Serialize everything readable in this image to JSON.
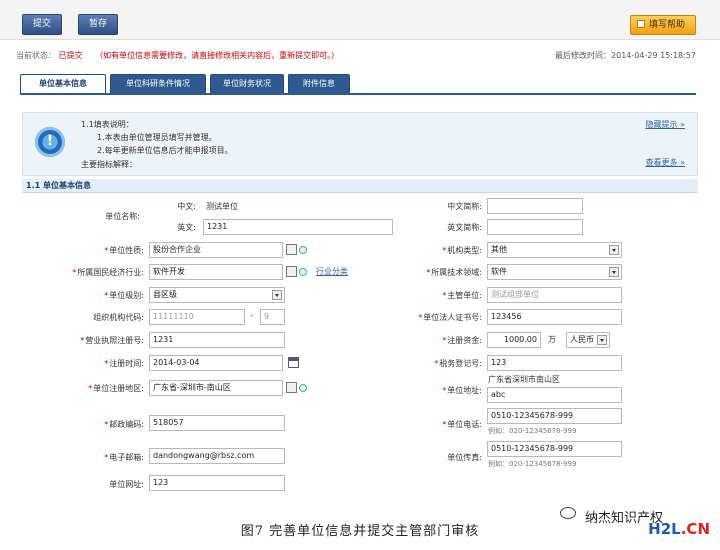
{
  "toolbar": {
    "submit": "提交",
    "save": "暂存",
    "help": "填写帮助"
  },
  "status": {
    "label": "当前状态：",
    "value": "已提交",
    "note": "（如有单位信息需要修改，请直接修改相关内容后，重新提交即可。）",
    "modified_label": "最后修改时间：",
    "modified_value": "2014-04-29 15:18:57"
  },
  "tabs": [
    "单位基本信息",
    "单位科研条件情况",
    "单位财务状况",
    "附件信息"
  ],
  "notice": {
    "line1": "1.1填表说明：",
    "line2": "1.本表由单位管理员填写并管理。",
    "line3": "2.每年更新单位信息后才能申报项目。",
    "line4": "主要指标解释：",
    "hide": "隐藏提示 »",
    "more": "查看更多 »"
  },
  "section_title": "1.1 单位基本信息",
  "form": {
    "unit_name": {
      "label": "单位名称:",
      "cn_label": "中文:",
      "cn_value": "测试单位",
      "en_label": "英文:",
      "en_value": "1231"
    },
    "abbr": {
      "cn_label": "中文简称:",
      "cn_value": "",
      "en_label": "英文简称:",
      "en_value": ""
    },
    "nature": {
      "label": "单位性质:",
      "value": "股份合作企业"
    },
    "org_type": {
      "label": "机构类型:",
      "value": "其他"
    },
    "industry": {
      "label": "所属国民经济行业:",
      "value": "软件开发",
      "link": "行业分类"
    },
    "tech_field": {
      "label": "所属技术领域:",
      "value": "软件"
    },
    "level": {
      "label": "单位级别:",
      "value": "县区级"
    },
    "supervisor": {
      "label": "主管单位:",
      "value": "测试组部单位"
    },
    "org_code": {
      "label": "组织机构代码:",
      "value": "11111110",
      "sep": "-",
      "check": "9"
    },
    "legal_cert": {
      "label": "单位法人证书号:",
      "value": "123456"
    },
    "license": {
      "label": "营业执照注册号:",
      "value": "1231"
    },
    "capital": {
      "label": "注册资金:",
      "value": "1000.00",
      "unit": "万",
      "currency": "人民币"
    },
    "reg_time": {
      "label": "注册时间:",
      "value": "2014-03-04"
    },
    "tax_no": {
      "label": "税务登记号:",
      "value": "123"
    },
    "region": {
      "label": "单位注册地区:",
      "value": "广东省-深圳市-南山区"
    },
    "address": {
      "label": "单位地址:",
      "prefix": "广东省深圳市南山区",
      "value": "abc"
    },
    "postcode": {
      "label": "邮政编码:",
      "value": "518057"
    },
    "phone": {
      "label": "单位电话:",
      "value": "0510-12345678-999",
      "hint": "例如：020-12345678-999"
    },
    "email": {
      "label": "电子邮箱:",
      "value": "dandongwang@rbsz.com"
    },
    "fax": {
      "label": "单位传真:",
      "value": "0510-12345678-999",
      "hint": "例如：020-12345678-999"
    },
    "website": {
      "label": "单位网址:",
      "value": "123"
    }
  },
  "caption": "图7  完善单位信息并提交主管部门审核",
  "watermark": {
    "account": "纳杰知识产权",
    "site_a": "H2L",
    "site_b": ".CN"
  }
}
